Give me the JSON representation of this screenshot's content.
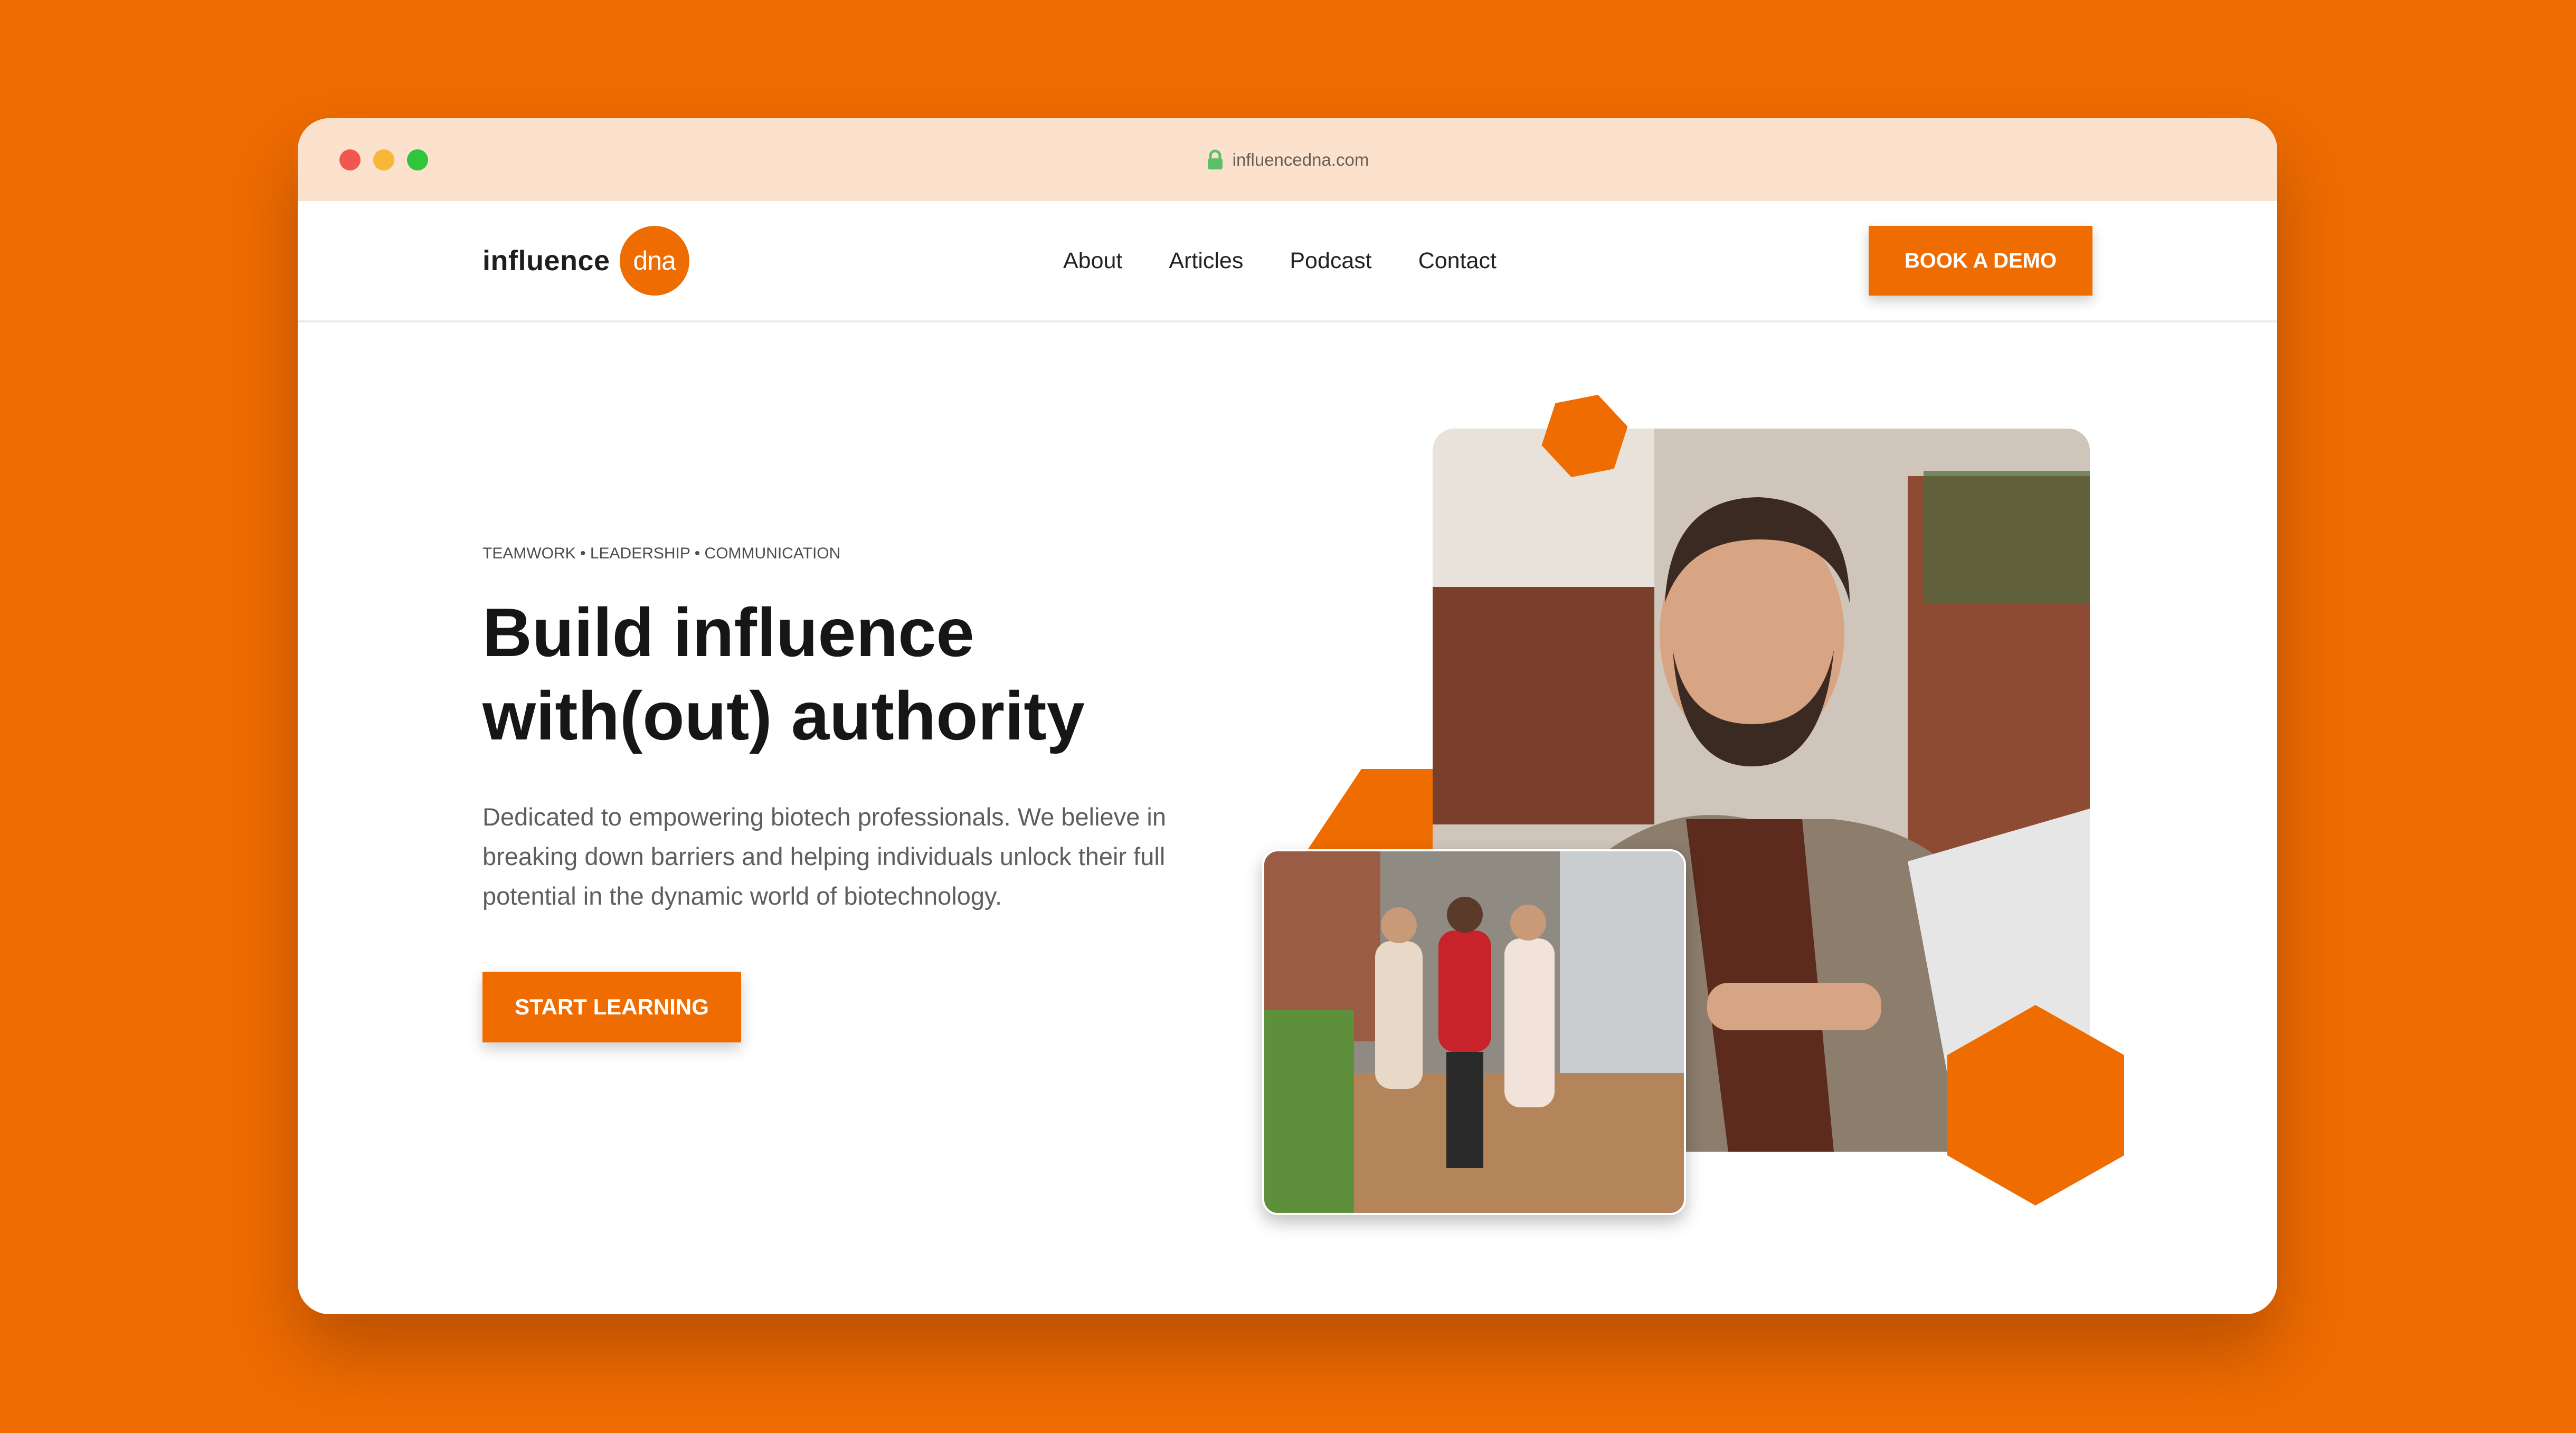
{
  "browser": {
    "url": "influencedna.com"
  },
  "header": {
    "logo_text": "influence",
    "logo_badge_text": "dna",
    "nav": [
      "About",
      "Articles",
      "Podcast",
      "Contact"
    ],
    "cta_label": "BOOK A DEMO"
  },
  "hero": {
    "eyebrow": "TEAMWORK • LEADERSHIP • COMMUNICATION",
    "headline_line1": "Build influence",
    "headline_line2": "with(out) authority",
    "lead": "Dedicated to empowering biotech professionals. We believe in breaking down barriers and helping individuals unlock their full potential in the dynamic world of biotechnology.",
    "cta_label": "START LEARNING"
  },
  "colors": {
    "accent": "#EE6C00",
    "titlebar": "#FCE1CC",
    "text_dark": "#161616",
    "text_body": "#5E5E5E"
  },
  "icons": [
    "lock-icon",
    "window-close-dot",
    "window-minimize-dot",
    "window-zoom-dot"
  ]
}
